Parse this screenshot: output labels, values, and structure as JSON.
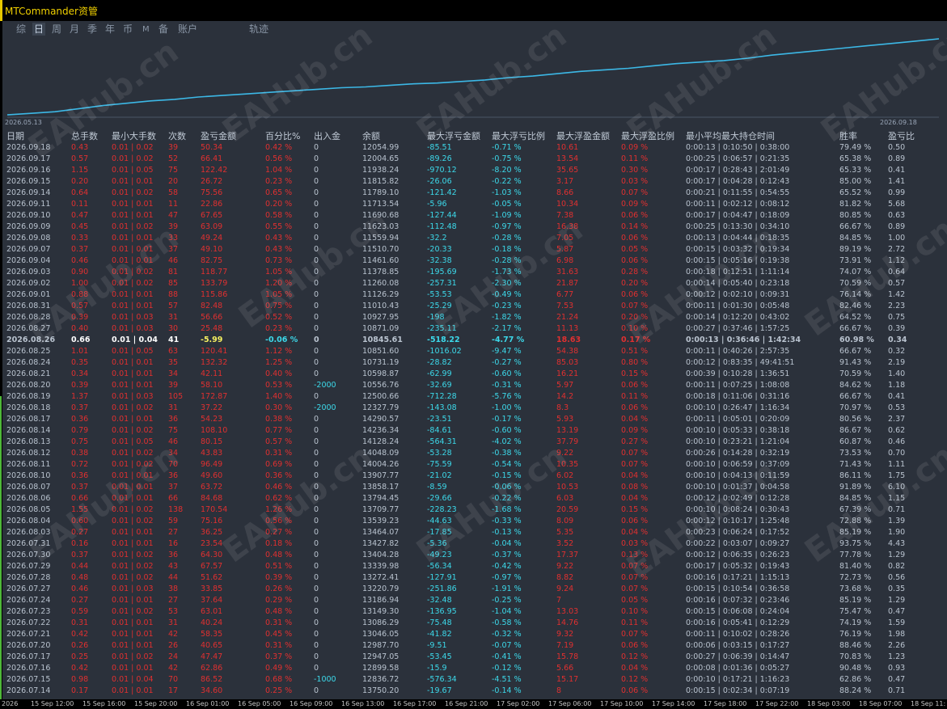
{
  "app": {
    "title": "MTCommander资管"
  },
  "tabs": [
    {
      "label": "综"
    },
    {
      "label": "日"
    },
    {
      "label": "周"
    },
    {
      "label": "月"
    },
    {
      "label": "季"
    },
    {
      "label": "年"
    },
    {
      "label": "币"
    },
    {
      "label": "M"
    },
    {
      "label": "备"
    },
    {
      "label": "账户"
    },
    {
      "label": "轨迹"
    }
  ],
  "active_tab": "日",
  "chart": {
    "start_date": "2026.05.13",
    "end_date": "2026.09.18",
    "line_color": "#3cb8e6",
    "balance_curve": [
      0.02,
      0.04,
      0.06,
      0.1,
      0.14,
      0.17,
      0.2,
      0.22,
      0.25,
      0.27,
      0.29,
      0.31,
      0.33,
      0.35,
      0.37,
      0.38,
      0.4,
      0.42,
      0.43,
      0.45,
      0.47,
      0.5,
      0.52,
      0.55,
      0.58,
      0.6,
      0.62,
      0.65,
      0.68,
      0.7,
      0.72,
      0.75,
      0.79,
      0.82,
      0.85,
      0.88,
      0.91,
      0.94,
      0.97,
      1.0
    ]
  },
  "watermark": "EAHub.cn",
  "table": {
    "headers": [
      "日期",
      "总手数",
      "最小大手数",
      "次数",
      "盈亏金额",
      "百分比%",
      "出入金",
      "余额",
      "最大浮亏金额",
      "最大浮亏比例",
      "最大浮盈金额",
      "最大浮盈比例",
      "最小平均最大持仓时间",
      "胜率",
      "盈亏比"
    ],
    "rows": [
      [
        "2026.09.18",
        "0.43",
        "0.01 | 0.02",
        "39",
        "50.34",
        "0.42 %",
        "0",
        "12054.99",
        "-85.51",
        "-0.71 %",
        "10.61",
        "0.09 %",
        "0:00:13 | 0:10:50 | 0:38:00",
        "79.49 %",
        "0.50"
      ],
      [
        "2026.09.17",
        "0.57",
        "0.01 | 0.02",
        "52",
        "66.41",
        "0.56 %",
        "0",
        "12004.65",
        "-89.26",
        "-0.75 %",
        "13.54",
        "0.11 %",
        "0:00:25 | 0:06:57 | 0:21:35",
        "65.38 %",
        "0.89"
      ],
      [
        "2026.09.16",
        "1.15",
        "0.01 | 0.05",
        "75",
        "122.42",
        "1.04 %",
        "0",
        "11938.24",
        "-970.12",
        "-8.20 %",
        "35.65",
        "0.30 %",
        "0:00:17 | 0:28:43 | 2:01:49",
        "65.33 %",
        "0.41"
      ],
      [
        "2026.09.15",
        "0.20",
        "0.01 | 0.01",
        "20",
        "26.72",
        "0.23 %",
        "0",
        "11815.82",
        "-26.06",
        "-0.22 %",
        "3.17",
        "0.03 %",
        "0:00:17 | 0:04:28 | 0:12:43",
        "85.00 %",
        "1.41"
      ],
      [
        "2026.09.14",
        "0.64",
        "0.01 | 0.02",
        "58",
        "75.56",
        "0.65 %",
        "0",
        "11789.10",
        "-121.42",
        "-1.03 %",
        "8.66",
        "0.07 %",
        "0:00:21 | 0:11:55 | 0:54:55",
        "65.52 %",
        "0.99"
      ],
      [
        "2026.09.11",
        "0.11",
        "0.01 | 0.01",
        "11",
        "22.86",
        "0.20 %",
        "0",
        "11713.54",
        "-5.96",
        "-0.05 %",
        "10.34",
        "0.09 %",
        "0:00:11 | 0:02:12 | 0:08:12",
        "81.82 %",
        "5.68"
      ],
      [
        "2026.09.10",
        "0.47",
        "0.01 | 0.01",
        "47",
        "67.65",
        "0.58 %",
        "0",
        "11690.68",
        "-127.44",
        "-1.09 %",
        "7.38",
        "0.06 %",
        "0:00:17 | 0:04:47 | 0:18:09",
        "80.85 %",
        "0.63"
      ],
      [
        "2026.09.09",
        "0.45",
        "0.01 | 0.02",
        "39",
        "63.09",
        "0.55 %",
        "0",
        "11623.03",
        "-112.48",
        "-0.97 %",
        "16.38",
        "0.14 %",
        "0:00:25 | 0:13:30 | 0:34:10",
        "66.67 %",
        "0.89"
      ],
      [
        "2026.09.08",
        "0.33",
        "0.01 | 0.01",
        "33",
        "49.24",
        "0.43 %",
        "0",
        "11559.94",
        "-32.2",
        "-0.28 %",
        "7.05",
        "0.06 %",
        "0:00:13 | 0:04:44 | 0:18:35",
        "84.85 %",
        "1.00"
      ],
      [
        "2026.09.07",
        "0.37",
        "0.01 | 0.01",
        "37",
        "49.10",
        "0.43 %",
        "0",
        "11510.70",
        "-20.33",
        "-0.18 %",
        "5.87",
        "0.05 %",
        "0:00:15 | 0:03:32 | 0:19:34",
        "89.19 %",
        "2.72"
      ],
      [
        "2026.09.04",
        "0.46",
        "0.01 | 0.01",
        "46",
        "82.75",
        "0.73 %",
        "0",
        "11461.60",
        "-32.38",
        "-0.28 %",
        "6.98",
        "0.06 %",
        "0:00:15 | 0:05:16 | 0:19:38",
        "73.91 %",
        "1.12"
      ],
      [
        "2026.09.03",
        "0.90",
        "0.01 | 0.02",
        "81",
        "118.77",
        "1.05 %",
        "0",
        "11378.85",
        "-195.69",
        "-1.73 %",
        "31.63",
        "0.28 %",
        "0:00:18 | 0:12:51 | 1:11:14",
        "74.07 %",
        "0.64"
      ],
      [
        "2026.09.02",
        "1.00",
        "0.01 | 0.02",
        "85",
        "133.79",
        "1.20 %",
        "0",
        "11260.08",
        "-257.31",
        "-2.30 %",
        "21.87",
        "0.20 %",
        "0:00:14 | 0:05:40 | 0:23:18",
        "70.59 %",
        "0.57"
      ],
      [
        "2026.09.01",
        "0.88",
        "0.01 | 0.01",
        "88",
        "115.86",
        "1.05 %",
        "0",
        "11126.29",
        "-53.53",
        "-0.49 %",
        "6.77",
        "0.06 %",
        "0:00:12 | 0:02:10 | 0:09:31",
        "76.14 %",
        "1.42"
      ],
      [
        "2026.08.31",
        "0.57",
        "0.01 | 0.01",
        "57",
        "82.48",
        "0.75 %",
        "0",
        "11010.43",
        "-25.29",
        "-0.23 %",
        "7.53",
        "0.07 %",
        "0:00:11 | 0:01:30 | 0:05:48",
        "82.46 %",
        "2.23"
      ],
      [
        "2026.08.28",
        "0.39",
        "0.01 | 0.03",
        "31",
        "56.66",
        "0.52 %",
        "0",
        "10927.95",
        "-198",
        "-1.82 %",
        "21.24",
        "0.20 %",
        "0:00:14 | 0:12:20 | 0:43:02",
        "64.52 %",
        "0.75"
      ],
      [
        "2026.08.27",
        "0.40",
        "0.01 | 0.03",
        "30",
        "25.48",
        "0.23 %",
        "0",
        "10871.09",
        "-235.11",
        "-2.17 %",
        "11.13",
        "0.10 %",
        "0:00:27 | 0:37:46 | 1:57:25",
        "66.67 %",
        "0.39"
      ],
      [
        "2026.08.26",
        "0.66",
        "0.01 | 0.04",
        "41",
        "-5.99",
        "-0.06 %",
        "0",
        "10845.61",
        "-518.22",
        "-4.77 %",
        "18.63",
        "0.17 %",
        "0:00:13 | 0:36:46 | 1:42:34",
        "60.98 %",
        "0.34"
      ],
      [
        "2026.08.25",
        "1.01",
        "0.01 | 0.05",
        "63",
        "120.41",
        "1.12 %",
        "0",
        "10851.60",
        "-1016.02",
        "-9.47 %",
        "54.38",
        "0.51 %",
        "0:00:11 | 0:40:26 | 2:57:35",
        "66.67 %",
        "0.32"
      ],
      [
        "2026.08.24",
        "0.35",
        "0.01 | 0.01",
        "35",
        "132.32",
        "1.25 %",
        "0",
        "10731.19",
        "-28.82",
        "-0.27 %",
        "85.03",
        "0.80 %",
        "0:00:12 | 0:83:35 | 49:41:51",
        "91.43 %",
        "2.19"
      ],
      [
        "2026.08.21",
        "0.34",
        "0.01 | 0.01",
        "34",
        "42.11",
        "0.40 %",
        "0",
        "10598.87",
        "-62.99",
        "-0.60 %",
        "16.21",
        "0.15 %",
        "0:00:39 | 0:10:28 | 1:36:51",
        "70.59 %",
        "1.40"
      ],
      [
        "2026.08.20",
        "0.39",
        "0.01 | 0.01",
        "39",
        "58.10",
        "0.53 %",
        "-2000",
        "10556.76",
        "-32.69",
        "-0.31 %",
        "5.97",
        "0.06 %",
        "0:00:11 | 0:07:25 | 1:08:08",
        "84.62 %",
        "1.18"
      ],
      [
        "2026.08.19",
        "1.37",
        "0.01 | 0.03",
        "105",
        "172.87",
        "1.40 %",
        "0",
        "12500.66",
        "-712.28",
        "-5.76 %",
        "14.2",
        "0.11 %",
        "0:00:18 | 0:11:06 | 0:31:16",
        "66.67 %",
        "0.41"
      ],
      [
        "2026.08.18",
        "0.37",
        "0.01 | 0.02",
        "31",
        "37.22",
        "0.30 %",
        "-2000",
        "12327.79",
        "-143.08",
        "-1.00 %",
        "8.3",
        "0.06 %",
        "0:00:10 | 0:26:47 | 1:16:34",
        "70.97 %",
        "0.53"
      ],
      [
        "2026.08.17",
        "0.36",
        "0.01 | 0.01",
        "36",
        "54.23",
        "0.38 %",
        "0",
        "14290.57",
        "-23.51",
        "-0.17 %",
        "5.93",
        "0.04 %",
        "0:00:11 | 0:05:01 | 0:20:09",
        "80.56 %",
        "2.37"
      ],
      [
        "2026.08.14",
        "0.79",
        "0.01 | 0.02",
        "75",
        "108.10",
        "0.77 %",
        "0",
        "14236.34",
        "-84.61",
        "-0.60 %",
        "13.19",
        "0.09 %",
        "0:00:10 | 0:05:33 | 0:38:18",
        "86.67 %",
        "0.62"
      ],
      [
        "2026.08.13",
        "0.75",
        "0.01 | 0.05",
        "46",
        "80.15",
        "0.57 %",
        "0",
        "14128.24",
        "-564.31",
        "-4.02 %",
        "37.79",
        "0.27 %",
        "0:00:10 | 0:23:21 | 1:21:04",
        "60.87 %",
        "0.46"
      ],
      [
        "2026.08.12",
        "0.38",
        "0.01 | 0.02",
        "34",
        "43.83",
        "0.31 %",
        "0",
        "14048.09",
        "-53.28",
        "-0.38 %",
        "9.22",
        "0.07 %",
        "0:00:26 | 0:14:28 | 0:32:19",
        "73.53 %",
        "0.70"
      ],
      [
        "2026.08.11",
        "0.72",
        "0.01 | 0.02",
        "70",
        "96.49",
        "0.69 %",
        "0",
        "14004.26",
        "-75.59",
        "-0.54 %",
        "10.35",
        "0.07 %",
        "0:00:10 | 0:06:59 | 0:37:09",
        "71.43 %",
        "1.11"
      ],
      [
        "2026.08.10",
        "0.36",
        "0.01 | 0.01",
        "36",
        "49.60",
        "0.36 %",
        "0",
        "13907.77",
        "-21.02",
        "-0.15 %",
        "6.02",
        "0.04 %",
        "0:00:10 | 0:04:13 | 0:11:59",
        "86.11 %",
        "1.75"
      ],
      [
        "2026.08.07",
        "0.37",
        "0.01 | 0.01",
        "37",
        "63.72",
        "0.46 %",
        "0",
        "13858.17",
        "-8.59",
        "-0.06 %",
        "10.53",
        "0.08 %",
        "0:00:10 | 0:01:37 | 0:04:58",
        "91.89 %",
        "6.10"
      ],
      [
        "2026.08.06",
        "0.66",
        "0.01 | 0.01",
        "66",
        "84.68",
        "0.62 %",
        "0",
        "13794.45",
        "-29.66",
        "-0.22 %",
        "6.03",
        "0.04 %",
        "0:00:12 | 0:02:49 | 0:12:28",
        "84.85 %",
        "1.15"
      ],
      [
        "2026.08.05",
        "1.55",
        "0.01 | 0.02",
        "138",
        "170.54",
        "1.26 %",
        "0",
        "13709.77",
        "-228.23",
        "-1.68 %",
        "20.59",
        "0.15 %",
        "0:00:10 | 0:08:24 | 0:30:43",
        "67.39 %",
        "0.71"
      ],
      [
        "2026.08.04",
        "0.60",
        "0.01 | 0.02",
        "59",
        "75.16",
        "0.56 %",
        "0",
        "13539.23",
        "-44.63",
        "-0.33 %",
        "8.09",
        "0.06 %",
        "0:00:12 | 0:10:17 | 1:25:48",
        "72.88 %",
        "1.39"
      ],
      [
        "2026.08.03",
        "0.27",
        "0.01 | 0.01",
        "27",
        "36.25",
        "0.27 %",
        "0",
        "13464.07",
        "-17.85",
        "-0.13 %",
        "5.35",
        "0.04 %",
        "0:00:23 | 0:06:24 | 0:17:52",
        "85.19 %",
        "1.90"
      ],
      [
        "2026.07.31",
        "0.16",
        "0.01 | 0.01",
        "16",
        "23.54",
        "0.18 %",
        "0",
        "13427.82",
        "-5.36",
        "-0.04 %",
        "3.52",
        "0.03 %",
        "0:00:22 | 0:03:07 | 0:09:27",
        "93.75 %",
        "4.43"
      ],
      [
        "2026.07.30",
        "0.37",
        "0.01 | 0.02",
        "36",
        "64.30",
        "0.48 %",
        "0",
        "13404.28",
        "-49.23",
        "-0.37 %",
        "17.37",
        "0.13 %",
        "0:00:12 | 0:06:35 | 0:26:23",
        "77.78 %",
        "1.29"
      ],
      [
        "2026.07.29",
        "0.44",
        "0.01 | 0.02",
        "43",
        "67.57",
        "0.51 %",
        "0",
        "13339.98",
        "-56.34",
        "-0.42 %",
        "9.22",
        "0.07 %",
        "0:00:17 | 0:05:32 | 0:19:43",
        "81.40 %",
        "0.82"
      ],
      [
        "2026.07.28",
        "0.48",
        "0.01 | 0.02",
        "44",
        "51.62",
        "0.39 %",
        "0",
        "13272.41",
        "-127.91",
        "-0.97 %",
        "8.82",
        "0.07 %",
        "0:00:16 | 0:17:21 | 1:15:13",
        "72.73 %",
        "0.56"
      ],
      [
        "2026.07.27",
        "0.46",
        "0.01 | 0.03",
        "38",
        "33.85",
        "0.26 %",
        "0",
        "13220.79",
        "-251.86",
        "-1.91 %",
        "9.24",
        "0.07 %",
        "0:00:15 | 0:10:54 | 0:36:58",
        "73.68 %",
        "0.35"
      ],
      [
        "2026.07.24",
        "0.27",
        "0.01 | 0.01",
        "27",
        "37.64",
        "0.29 %",
        "0",
        "13186.94",
        "-32.48",
        "-0.25 %",
        "7",
        "0.05 %",
        "0:00:16 | 0:07:32 | 0:23:46",
        "85.19 %",
        "1.29"
      ],
      [
        "2026.07.23",
        "0.59",
        "0.01 | 0.02",
        "53",
        "63.01",
        "0.48 %",
        "0",
        "13149.30",
        "-136.95",
        "-1.04 %",
        "13.03",
        "0.10 %",
        "0:00:15 | 0:06:08 | 0:24:04",
        "75.47 %",
        "0.47"
      ],
      [
        "2026.07.22",
        "0.31",
        "0.01 | 0.01",
        "31",
        "40.24",
        "0.31 %",
        "0",
        "13086.29",
        "-75.48",
        "-0.58 %",
        "14.76",
        "0.11 %",
        "0:00:16 | 0:05:41 | 0:12:29",
        "74.19 %",
        "1.59"
      ],
      [
        "2026.07.21",
        "0.42",
        "0.01 | 0.01",
        "42",
        "58.35",
        "0.45 %",
        "0",
        "13046.05",
        "-41.82",
        "-0.32 %",
        "9.32",
        "0.07 %",
        "0:00:11 | 0:10:02 | 0:28:26",
        "76.19 %",
        "1.98"
      ],
      [
        "2026.07.20",
        "0.26",
        "0.01 | 0.01",
        "26",
        "40.65",
        "0.31 %",
        "0",
        "12987.70",
        "-9.51",
        "-0.07 %",
        "7.19",
        "0.06 %",
        "0:00:06 | 0:03:15 | 0:17:27",
        "88.46 %",
        "2.26"
      ],
      [
        "2026.07.17",
        "0.25",
        "0.01 | 0.02",
        "24",
        "47.47",
        "0.37 %",
        "0",
        "12947.05",
        "-53.45",
        "-0.41 %",
        "15.78",
        "0.12 %",
        "0:00:27 | 0:06:39 | 0:14:47",
        "70.83 %",
        "1.23"
      ],
      [
        "2026.07.16",
        "0.42",
        "0.01 | 0.01",
        "42",
        "62.86",
        "0.49 %",
        "0",
        "12899.58",
        "-15.9",
        "-0.12 %",
        "5.66",
        "0.04 %",
        "0:00:08 | 0:01:36 | 0:05:27",
        "90.48 %",
        "0.93"
      ],
      [
        "2026.07.15",
        "0.98",
        "0.01 | 0.04",
        "70",
        "86.52",
        "0.68 %",
        "-1000",
        "12836.72",
        "-576.34",
        "-4.51 %",
        "15.17",
        "0.12 %",
        "0:00:10 | 0:17:21 | 1:16:23",
        "62.86 %",
        "0.47"
      ],
      [
        "2026.07.14",
        "0.17",
        "0.01 | 0.01",
        "17",
        "34.60",
        "0.25 %",
        "0",
        "13750.20",
        "-19.67",
        "-0.14 %",
        "8",
        "0.06 %",
        "0:00:15 | 0:02:34 | 0:07:19",
        "88.24 %",
        "0.71"
      ]
    ],
    "highlight_row_date": "2026.08.26"
  },
  "time_axis": [
    "2026",
    "15 Sep 12:00",
    "15 Sep 16:00",
    "15 Sep 20:00",
    "16 Sep 01:00",
    "16 Sep 05:00",
    "16 Sep 09:00",
    "16 Sep 13:00",
    "16 Sep 17:00",
    "16 Sep 21:00",
    "17 Sep 02:00",
    "17 Sep 06:00",
    "17 Sep 10:00",
    "17 Sep 14:00",
    "17 Sep 18:00",
    "17 Sep 22:00",
    "18 Sep 03:00",
    "18 Sep 07:00",
    "18 Sep 11:"
  ]
}
